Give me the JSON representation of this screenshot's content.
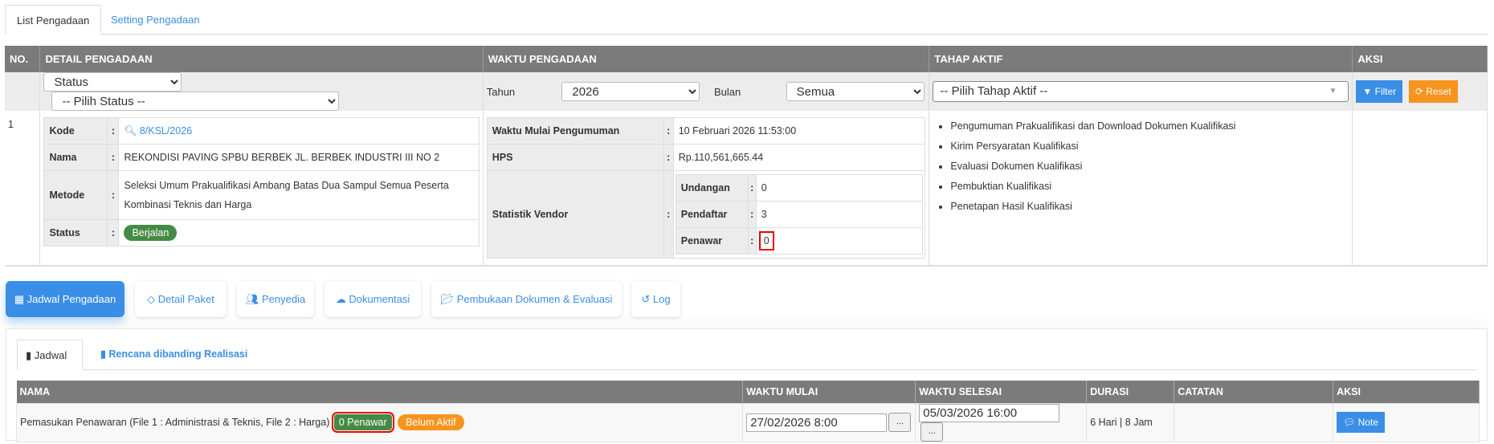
{
  "tabs": {
    "list": "List Pengadaan",
    "setting": "Setting Pengadaan"
  },
  "main_table": {
    "headers": {
      "no": "NO.",
      "detail": "DETAIL PENGADAAN",
      "waktu": "WAKTU PENGADAAN",
      "tahap": "TAHAP AKTIF",
      "aksi": "AKSI"
    },
    "filters": {
      "status_field": "Status",
      "status_value": "-- Pilih Status --",
      "tahun_label": "Tahun",
      "tahun_value": "2026",
      "bulan_label": "Bulan",
      "bulan_value": "Semua",
      "tahap_value": "-- Pilih Tahap Aktif --",
      "filter_btn": "Filter",
      "reset_btn": "Reset"
    },
    "row": {
      "no": "1",
      "kode_label": "Kode",
      "kode": "8/KSL/2026",
      "nama_label": "Nama",
      "nama": "REKONDISI PAVING SPBU BERBEK JL. BERBEK INDUSTRI III NO 2",
      "metode_label": "Metode",
      "metode_line1": "Seleksi Umum Prakualifikasi Ambang Batas Dua Sampul Semua Peserta",
      "metode_line2": "Kombinasi Teknis dan Harga",
      "status_label": "Status",
      "status": "Berjalan",
      "waktu_label": "Waktu Mulai Pengumuman",
      "waktu": "10 Februari 2026 11:53:00",
      "hps_label": "HPS",
      "hps": "Rp.110,561,665.44",
      "stat_label": "Statistik Vendor",
      "undangan_label": "Undangan",
      "undangan": "0",
      "pendaftar_label": "Pendaftar",
      "pendaftar": "3",
      "penawar_label": "Penawar",
      "penawar": "0",
      "colon": ":",
      "tahap": [
        "Pengumuman Prakualifikasi dan Download Dokumen Kualifikasi",
        "Kirim Persyaratan Kualifikasi",
        "Evaluasi Dokumen Kualifikasi",
        "Pembuktian Kualifikasi",
        "Penetapan Hasil Kualifikasi"
      ]
    }
  },
  "nav": [
    "Jadwal Pengadaan",
    "Detail Paket",
    "Penyedia",
    "Dokumentasi",
    "Pembukaan Dokumen & Evaluasi",
    "Log"
  ],
  "inner_tabs": {
    "jadwal": "Jadwal",
    "rencana": "Rencana dibanding Realisasi"
  },
  "jadwal_table": {
    "headers": [
      "NAMA",
      "WAKTU MULAI",
      "WAKTU SELESAI",
      "DURASI",
      "CATATAN",
      "AKSI"
    ],
    "row": {
      "nama": "Pemasukan Penawaran (File 1 : Administrasi & Teknis, File 2 : Harga)",
      "penawar_badge": "0 Penawar",
      "status_badge": "Belum Aktif",
      "mulai": "27/02/2026 8:00",
      "selesai": "05/03/2026 16:00",
      "picker": "...",
      "durasi": "6 Hari | 8 Jam",
      "catatan": "",
      "note_btn": "Note"
    }
  },
  "colors": {
    "accent": "#3a8ee6",
    "green": "#458a44",
    "orange": "#f7941d",
    "header": "#7b7b7b"
  }
}
